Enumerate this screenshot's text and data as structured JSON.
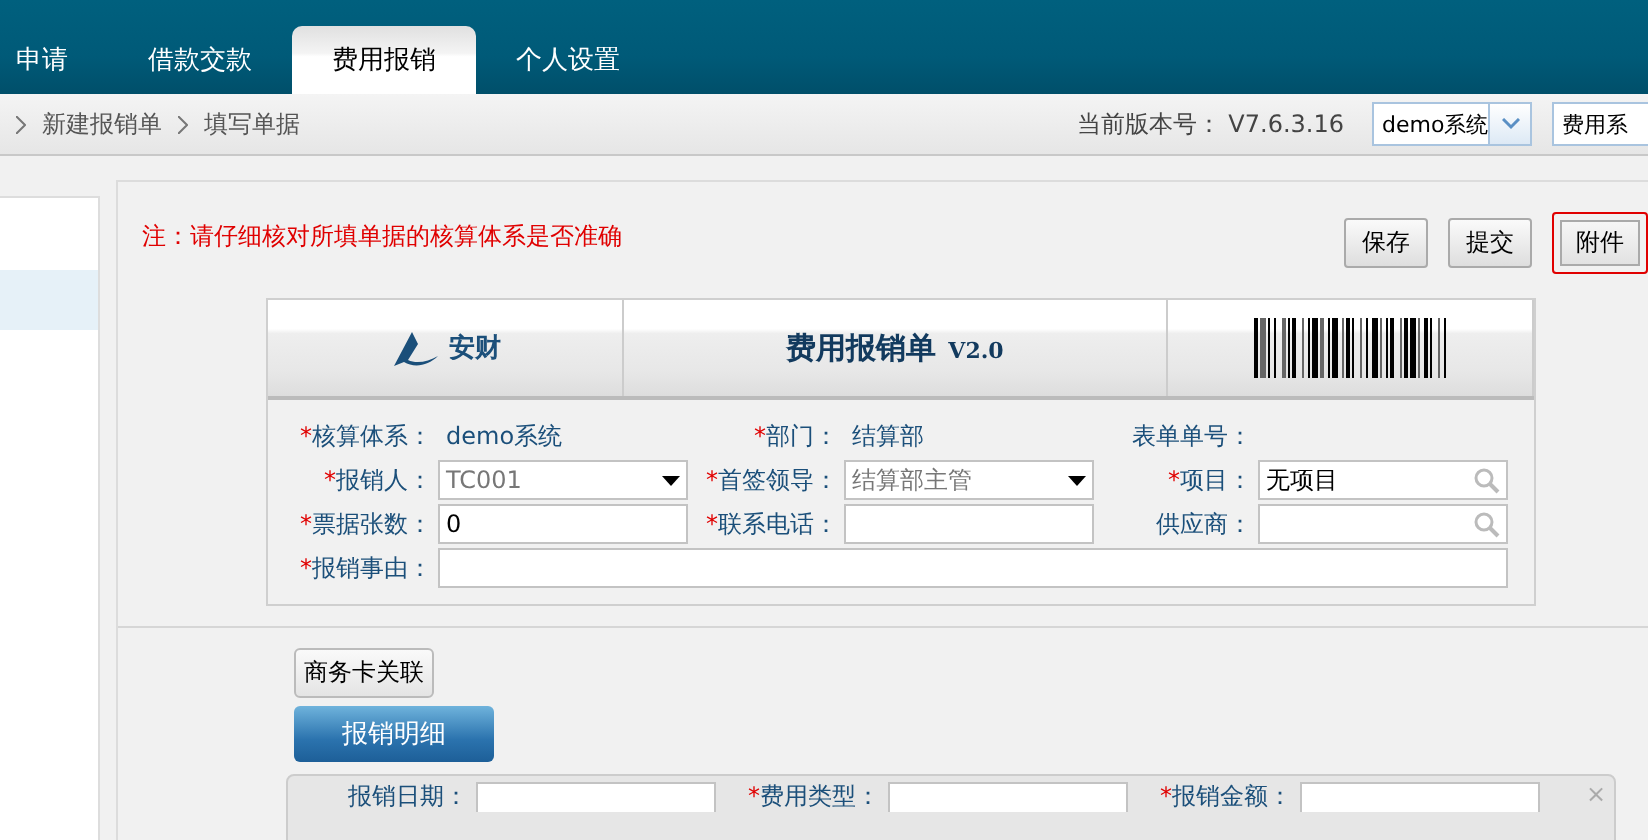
{
  "nav_tabs": [
    {
      "label": "申请",
      "selected": false
    },
    {
      "label": "借款交款",
      "selected": false
    },
    {
      "label": "费用报销",
      "selected": true
    },
    {
      "label": "个人设置",
      "selected": false
    }
  ],
  "breadcrumb": [
    "新建报销单",
    "填写单据"
  ],
  "version": {
    "label": "当前版本号：",
    "value": "V7.6.3.16"
  },
  "system_select": {
    "value": "demo系统"
  },
  "module_field": {
    "value": "费用系"
  },
  "notice": "注：请仔细核对所填单据的核算体系是否准确",
  "actions": [
    {
      "label": "保存",
      "highlighted": false
    },
    {
      "label": "提交",
      "highlighted": false
    },
    {
      "label": "附件",
      "highlighted": true
    }
  ],
  "form": {
    "logo_text": "安财",
    "title": "费用报销单",
    "version": "V2.0",
    "rows": [
      [
        {
          "label": "核算体系：",
          "required": true,
          "kind": "text",
          "value": "demo系统"
        },
        {
          "label": "部门：",
          "required": true,
          "kind": "text",
          "value": "结算部"
        },
        {
          "label": "表单单号：",
          "required": false,
          "kind": "text"
        }
      ],
      [
        {
          "label": "报销人：",
          "required": true,
          "kind": "select",
          "value": "TC001"
        },
        {
          "label": "首签领导：",
          "required": true,
          "kind": "select",
          "value": "结算部主管"
        },
        {
          "label": "项目：",
          "required": true,
          "kind": "lookup",
          "value": "无项目"
        }
      ],
      [
        {
          "label": "票据张数：",
          "required": true,
          "kind": "input",
          "value": "0"
        },
        {
          "label": "联系电话：",
          "required": true,
          "kind": "input"
        },
        {
          "label": "供应商：",
          "required": false,
          "kind": "lookup"
        }
      ],
      [
        {
          "label": "报销事由：",
          "required": true,
          "kind": "wide"
        }
      ]
    ]
  },
  "card_link_button": "商务卡关联",
  "detail_tab": {
    "label": "报销明细",
    "selected": true
  },
  "detail_fields": [
    {
      "label": "报销日期：",
      "required": false
    },
    {
      "label": "费用类型：",
      "required": true
    },
    {
      "label": "报销金额：",
      "required": true
    }
  ],
  "detail_close": "×",
  "required_mark": "*"
}
